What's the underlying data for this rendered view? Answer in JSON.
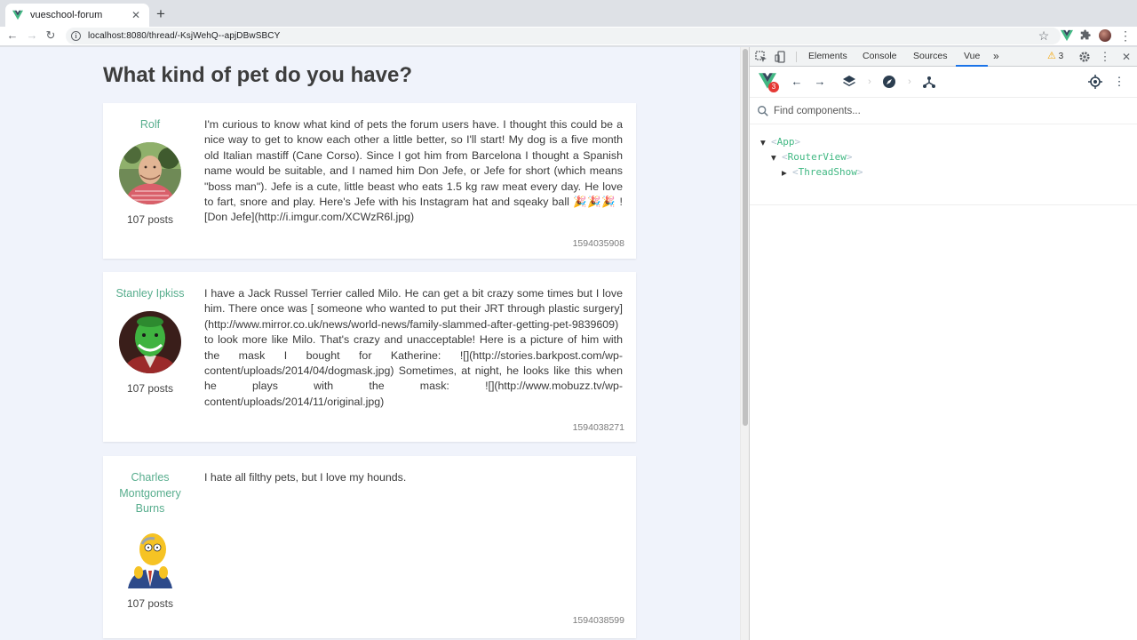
{
  "browser": {
    "tab_title": "vueschool-forum",
    "tab_close": "✕",
    "new_tab": "+",
    "url_host": "localhost",
    "url_rest": ":8080/thread/-KsjWehQ--apjDBwSBCY",
    "icons": {
      "back": "←",
      "forward": "→",
      "reload": "↻",
      "info": "i",
      "star": "☆",
      "extensions": "puzzle",
      "menu": "⋮"
    }
  },
  "page": {
    "thread_title": "What kind of pet do you have?",
    "posts": [
      {
        "user": "Rolf",
        "post_count": "107 posts",
        "text": "I'm curious to know what kind of pets the forum users have. I thought this could be a nice way to get to know each other a little better, so I'll start! My dog is a five month old Italian mastiff (Cane Corso). Since I got him from Barcelona I thought a Spanish name would be suitable, and I named him Don Jefe, or Jefe for short (which means \"boss man\"). Jefe is a cute, little beast who eats 1.5 kg raw meat every day. He love to fart, snore and play. Here's Jefe with his Instagram hat and sqeaky ball 🎉🎉🎉 ![Don Jefe](http://i.imgur.com/XCWzR6l.jpg)",
        "timestamp": "1594035908"
      },
      {
        "user": "Stanley Ipkiss",
        "post_count": "107 posts",
        "text": "I have a Jack Russel Terrier called Milo. He can get a bit crazy some times but I love him. There once was [ someone who wanted to put their JRT through plastic surgery](http://www.mirror.co.uk/news/world-news/family-slammed-after-getting-pet-9839609) to look more like Milo. That's crazy and unacceptable! Here is a picture of him with the mask I bought for Katherine: ![](http://stories.barkpost.com/wp-content/uploads/2014/04/dogmask.jpg) Sometimes, at night, he looks like this when he plays with the mask: ![](http://www.mobuzz.tv/wp-content/uploads/2014/11/original.jpg)",
        "timestamp": "1594038271"
      },
      {
        "user": "Charles Montgomery Burns",
        "post_count": "107 posts",
        "text": "I hate all filthy pets, but I love my hounds.",
        "timestamp": "1594038599"
      }
    ]
  },
  "devtools": {
    "tabs": [
      "Elements",
      "Console",
      "Sources",
      "Vue"
    ],
    "active_tab": "Vue",
    "more": "»",
    "warning_count": "3",
    "vue_badge": "3",
    "search_placeholder": "Find components...",
    "tree": [
      {
        "name": "App",
        "depth": 0,
        "expanded": true
      },
      {
        "name": "RouterView",
        "depth": 1,
        "expanded": true
      },
      {
        "name": "ThreadShow",
        "depth": 2,
        "expanded": false
      }
    ]
  }
}
